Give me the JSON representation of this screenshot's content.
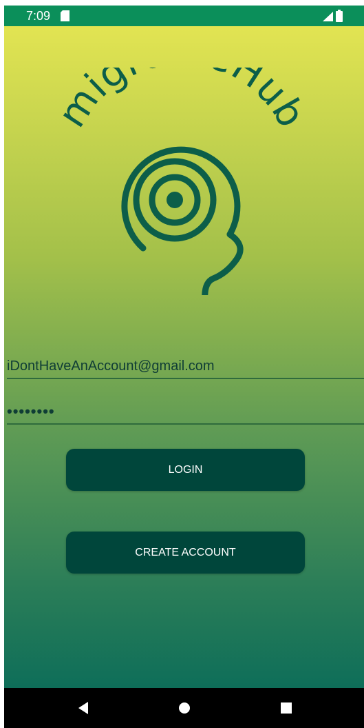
{
  "status_bar": {
    "time": "7:09",
    "icons": [
      "sd-card-icon",
      "signal-icon",
      "battery-icon"
    ]
  },
  "logo": {
    "text": "migraineHub",
    "icon": "head-spiral-icon",
    "color": "#0c5e49"
  },
  "login_form": {
    "email_value": "iDontHaveAnAccount@gmail.com",
    "password_mask": "••••••••",
    "login_label": "LOGIN",
    "create_account_label": "CREATE ACCOUNT"
  },
  "nav_bar": {
    "icons": [
      "back-icon",
      "home-icon",
      "recents-icon"
    ]
  },
  "colors": {
    "status_bar": "#0b8f5a",
    "gradient_top": "#e2e452",
    "gradient_bottom": "#0e6e59",
    "button": "#00463b",
    "button_text": "#ffffff"
  }
}
